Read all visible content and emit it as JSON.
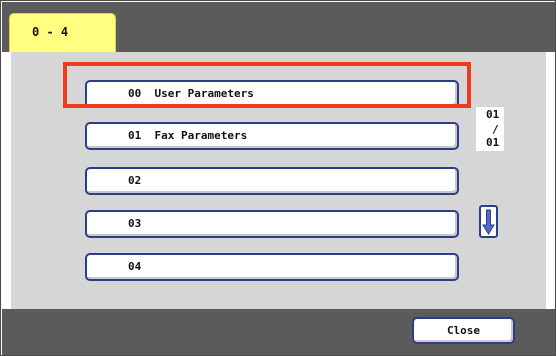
{
  "tab": {
    "label": "0 - 4"
  },
  "menu": {
    "items": [
      {
        "label": "00  User Parameters"
      },
      {
        "label": "01  Fax Parameters"
      },
      {
        "label": "02"
      },
      {
        "label": "03"
      },
      {
        "label": "04"
      }
    ],
    "selected_index": 1
  },
  "pager": {
    "current": "01",
    "separator": "/",
    "total": "01"
  },
  "icons": {
    "up": "arrow-up-icon",
    "down": "arrow-down-icon"
  },
  "footer": {
    "close_label": "Close"
  },
  "colors": {
    "highlight": "#ee3a1f",
    "tab": "#ffff80",
    "header": "#5b5b5b",
    "panel": "#d6d6d6",
    "button_border": "#2a3f86",
    "arrow": "#5868c8"
  }
}
